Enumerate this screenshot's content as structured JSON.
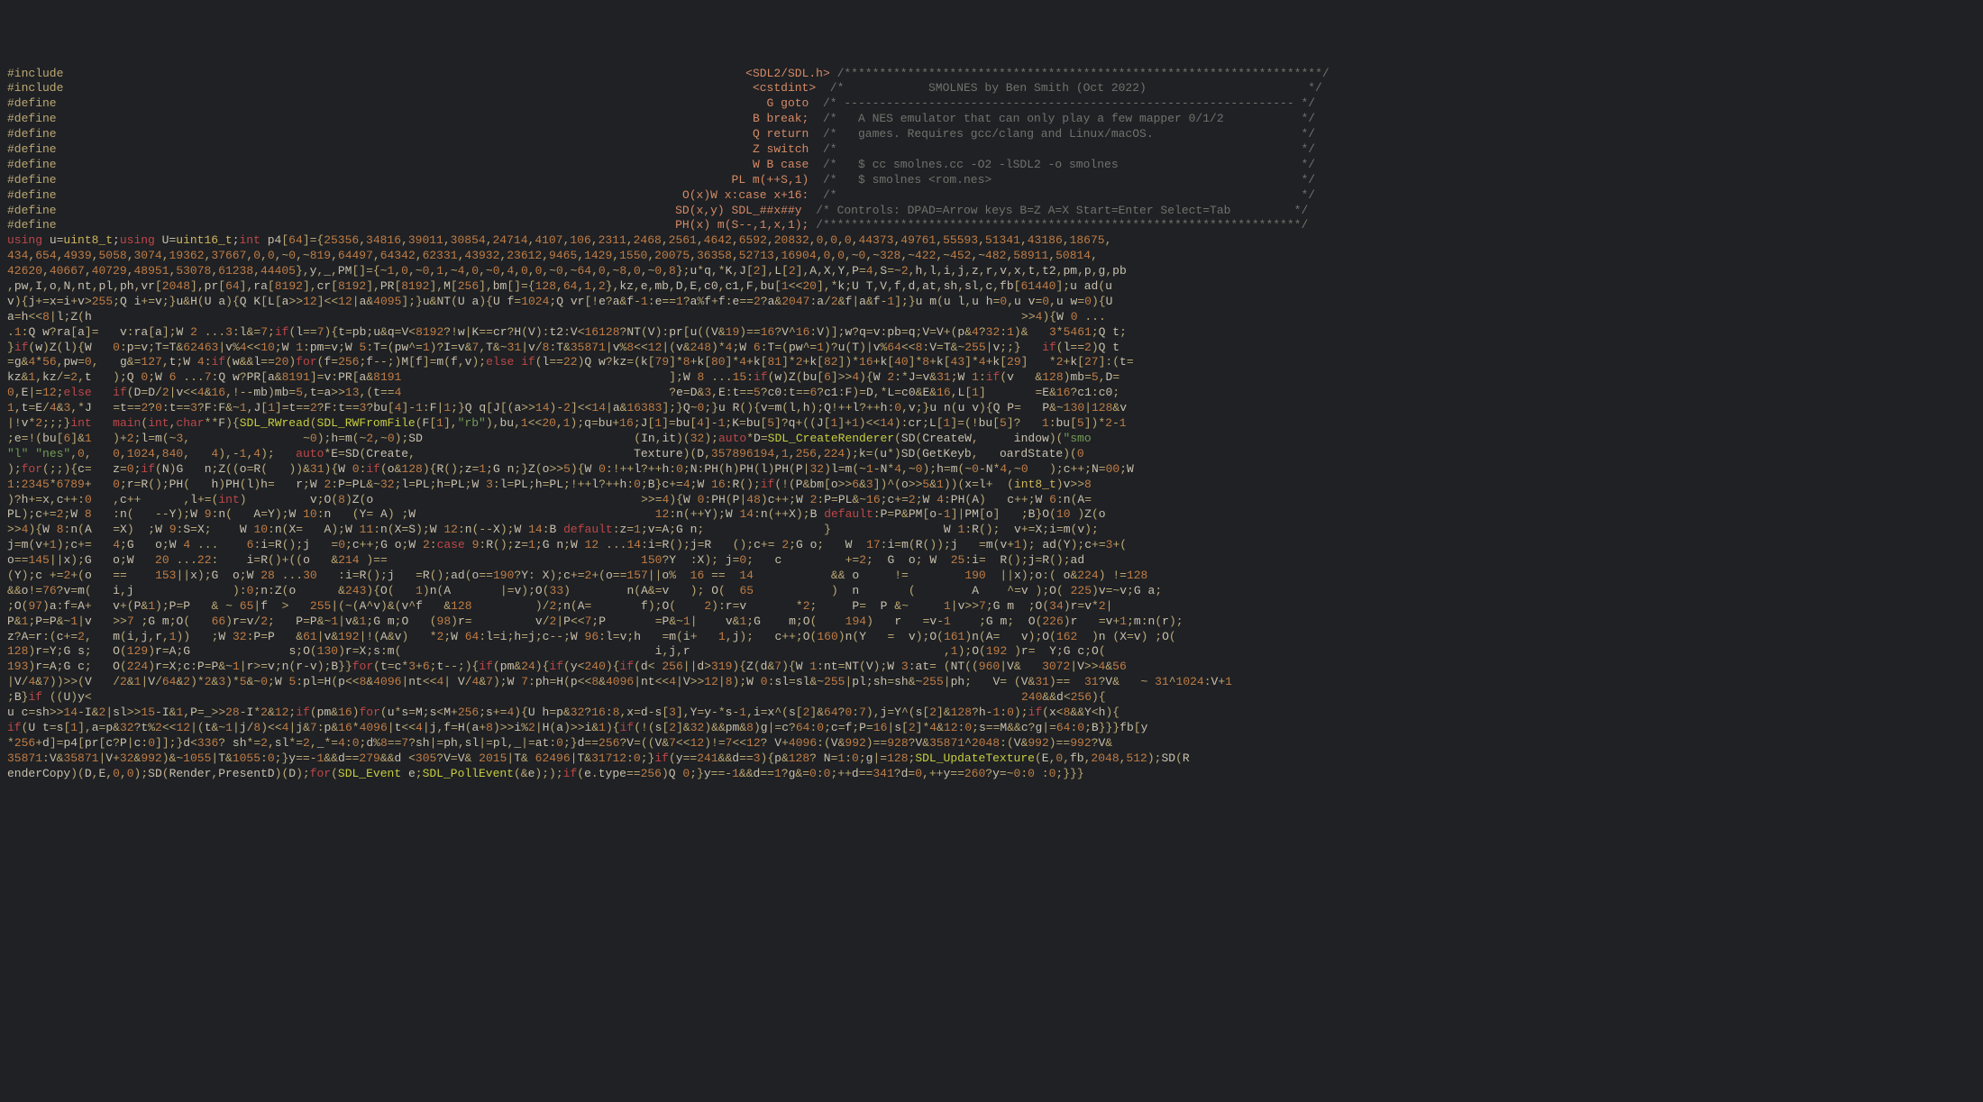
{
  "lines": [
    {
      "pp": "#include",
      "pad": "                                                                                                 ",
      "mac": "<SDL2/SDL.h>",
      "cmt": " /********************************************************************/"
    },
    {
      "pp": "#include",
      "pad": "                                                                                                  ",
      "mac": "<cstdint>",
      "cmt": "  /*            SMOLNES by Ben Smith (Oct 2022)                       */"
    },
    {
      "pp": "#define",
      "pad": "                                                                                                     ",
      "mac": "G goto",
      "cmt": "  /* ---------------------------------------------------------------- */"
    },
    {
      "pp": "#define",
      "pad": "                                                                                                   ",
      "mac": "B break;",
      "cmt": "  /*   A NES emulator that can only play a few mapper 0/1/2           */"
    },
    {
      "pp": "#define",
      "pad": "                                                                                                   ",
      "mac": "Q return",
      "cmt": "  /*   games. Requires gcc/clang and Linux/macOS.                     */"
    },
    {
      "pp": "#define",
      "pad": "                                                                                                   ",
      "mac": "Z switch",
      "cmt": "  /*                                                                  */"
    },
    {
      "pp": "#define",
      "pad": "                                                                                                   ",
      "mac": "W B case",
      "cmt": "  /*   $ cc smolnes.cc -O2 -lSDL2 -o smolnes                          */"
    },
    {
      "pp": "#define",
      "pad": "                                                                                                ",
      "mac": "PL m(++S,1)",
      "cmt": "  /*   $ smolnes <rom.nes>                                            */"
    },
    {
      "pp": "#define",
      "pad": "                                                                                         ",
      "mac": "O(x)W x:case x+16:",
      "cmt": "  /*                                                                  */"
    },
    {
      "pp": "#define",
      "pad": "                                                                                        ",
      "mac": "SD(x,y) SDL_##x##y",
      "cmt": "  /* Controls: DPAD=Arrow keys B=Z A=X Start=Enter Select=Tab         */"
    },
    {
      "pp": "#define",
      "pad": "                                                                                        ",
      "mac": "PH(x) m(S--,1,x,1);",
      "cmt": " /********************************************************************/"
    },
    {
      "kw": "using ",
      "id": "u=",
      "ty": "uint8_t",
      "id2": ";",
      "kw2": "using ",
      "id3": "U=",
      "ty2": "uint16_t",
      "id4": ";",
      "kw3": "int ",
      "rest": "p4[64]={25356,34816,39011,30854,24714,4107,106,2311,2468,2561,4642,6592,20832,0,0,0,44373,49761,55593,51341,43186,18675,"
    },
    {
      "rest": "434,654,4939,5058,3074,19362,37667,0,0,~0,~819,64497,64342,62331,43932,23612,9465,1429,1550,20075,36358,52713,16904,0,0,~0,~328,~422,~452,~482,58911,50814,"
    },
    {
      "rest": "42620,40667,40729,48951,53078,61238,44405},y,_,PM[]={~1,0,~0,1,~4,0,~0,4,0,0,~0,~64,0,~8,0,~0,8};u*q,*K,J[2],L[2],A,X,Y,P=4,S=~2,h,l,i,j,z,r,v,x,t,t2,pm,p,g,pb"
    },
    {
      "rest": ",pw,I,o,N,nt,pl,ph,vr[2048],pr[64],ra[8192],cr[8192],PR[8192],M[256],bm[]={128,64,1,2},kz,e,mb,D,E,c0,c1,F,bu[1<<20],*k;U T,V,f,d,at,sh,sl,c,fb[61440];u ad(u"
    },
    {
      "rest": "v){j+=x=i+v>255;Q i+=v;}u&H(U a){Q K[L[a>>12]<<12|a&4095];}u&NT(U a){U f=1024;Q vr[!e?a&f-1:e==1?a%f+f:e==2?a&2047:a/2&f|a&f-1];}u m(u l,u h=0,u v=0,u w=0){U"
    },
    {
      "rest": "a=h<<8|l;Z(h                                                                                                                                    >>4){W 0 ..."
    },
    {
      "rest": ".1:Q w?ra[a]=   v:ra[a];W 2 ...3:l&=7;if(l==7){t=pb;u&q=V<8192?!w|K==cr?H(V):t2:V<16128?NT(V):pr[u((V&19)==16?V^16:V)];w?q=v:pb=q;V=V+(p&4?32:1)&   3*5461;Q t;"
    },
    {
      "rest": "}if(w)Z(l){W   0:p=v;T=T&62463|v%4<<10;W 1:pm=v;W 5:T=(pw^=1)?I=v&7,T&~31|v/8:T&35871|v%8<<12|(v&248)*4;W 6:T=(pw^=1)?u(T)|v%64<<8:V=T&~255|v;;}   if(l==2)Q t"
    },
    {
      "rest": "=g&4*56,pw=0,   g&=127,t;W 4:if(w&&l==20)for(f=256;f--;)M[f]=m(f,v);else if(l==22)Q w?kz=(k[79]*8+k[80]*4+k[81]*2+k[82])*16+k[40]*8+k[43]*4+k[29]   *2+k[27]:(t="
    },
    {
      "rest": "kz&1,kz/=2,t   );Q 0;W 6 ...7:Q w?PR[a&8191]=v:PR[a&8191                                      ];W 8 ...15:if(w)Z(bu[6]>>4){W 2:*J=v&31;W 1:if(v   &128)mb=5,D="
    },
    {
      "rest": "0,E|=12;else   if(D=D/2|v<<4&16,!--mb)mb=5,t=a>>13,(t==4                                      ?e=D&3,E:t==5?c0:t==6?c1:F)=D,*L=c0&E&16,L[1]       =E&16?c1:c0;"
    },
    {
      "rest": "1,t=E/4&3,*J   =t==2?0:t==3?F:F&~1,J[1]=t==2?F:t==3?bu[4]-1:F|1;}Q q[J[(a>>14)-2]<<14|a&16383];}Q~0;}u R(){v=m(l,h);Q!++l?++h:0,v;}u n(u v){Q P=   P&~130|128&v"
    },
    {
      "rest": "|!v*2;;;}int   main(int,char**F){SDL_RWread(SDL_RWFromFile(F[1],\"rb\"),bu,1<<20,1);q=bu+16;J[1]=bu[4]-1;K=bu[5]?q+((J[1]+1)<<14):cr;L[1]=(!bu[5]?   1:bu[5])*2-1"
    },
    {
      "rest": ";e=!(bu[6]&1   )+2;l=m(~3,                ~0);h=m(~2,~0);SD                              (In,it)(32);auto*D=SDL_CreateRenderer(SD(CreateW,     indow)(\"smo"
    },
    {
      "rest": "\"l\" \"nes\",0,   0,1024,840,   4),-1,4);   auto*E=SD(Create,                               Texture)(D,357896194,1,256,224);k=(u*)SD(GetKeyb,   oardState)(0"
    },
    {
      "rest": ");for(;;){c=   z=0;if(N)G   n;Z((o=R(   ))&31){W 0:if(o&128){R();z=1;G n;}Z(o>>5){W 0:!++l?++h:0;N:PH(h)PH(l)PH(P|32)l=m(~1-N*4,~0);h=m(~0-N*4,~0   );c++;N=00;W"
    },
    {
      "rest": "1:2345*6789+   0;r=R();PH(   h)PH(l)h=   r;W 2:P=PL&~32;l=PL;h=PL;W 3:l=PL;h=PL;!++l?++h:0;B}c+=4;W 16:R();if(!(P&bm[o>>6&3])^(o>>5&1))(x=l+  (int8_t)v>>8"
    },
    {
      "rest": ")?h+=x,c++:0   ,c++      ,l+=(int)         v;O(8)Z(o                                      >>=4){W 0:PH(P|48)c++;W 2:P=PL&~16;c+=2;W 4:PH(A)   c++;W 6:n(A="
    },
    {
      "rest": "PL);c+=2;W 8   :n(   --Y);W 9:n(   A=Y);W 10:n   (Y= A) ;W                                  12:n(++Y);W 14:n(++X);B default:P=P&PM[o-1]|PM[o]   ;B}O(10 )Z(o"
    },
    {
      "rest": ">>4){W 8:n(A   =X)  ;W 9:S=X;    W 10:n(X=   A);W 11:n(X=S);W 12:n(--X);W 14:B default:z=1;v=A;G n;                 }                W 1:R();  v+=X;i=m(v);"
    },
    {
      "rest": "j=m(v+1);c+=   4;G   o;W 4 ...    6:i=R();j   =0;c++;G o;W 2:case 9:R();z=1;G n;W 12 ...14:i=R();j=R   ();c+= 2;G o;   W  17:i=m(R());j   =m(v+1); ad(Y);c+=3+("
    },
    {
      "rest": "o==145||x);G   o;W   20 ...22:    i=R()+((o   &214 )==                                    150?Y  :X); j=0;   c         +=2;  G  o; W  25:i=  R();j=R();ad"
    },
    {
      "rest": "(Y);c +=2+(o   ==    153||x);G  o;W 28 ...30   :i=R();j   =R();ad(o==190?Y: X);c+=2+(o==157||o%  16 ==  14           && o     !=        190  ||x);o:( o&224) !=128"
    },
    {
      "rest": "&&o!=76?v=m(   i,j              ):0;n:Z(o      &243){O(   1)n(A       |=v);O(33)        n(A&=v   ); O(  65           )  n       (        A    ^=v );O( 225)v=~v;G a;"
    },
    {
      "rest": ";O(97)a:f=A+   v+(P&1);P=P   & ~ 65|f  >   255|(~(A^v)&(v^f   &128         )/2;n(A=       f);O(    2):r=v       *2;     P=  P &~     1|v>>7;G m  ;O(34)r=v*2|"
    },
    {
      "rest": "P&1;P=P&~1|v   >>7 ;G m;O(   66)r=v/2;   P=P&~1|v&1;G m;O   (98)r=         v/2|P<<7;P       =P&~1|    v&1;G    m;O(    194)   r   =v-1    ;G m;  O(226)r   =v+1;m:n(r);"
    },
    {
      "rest": "z?A=r:(c+=2,   m(i,j,r,1))   ;W 32:P=P   &61|v&192|!(A&v)   *2;W 64:l=i;h=j;c--;W 96:l=v;h   =m(i+   1,j);   c++;O(160)n(Y   =  v);O(161)n(A=   v);O(162  )n (X=v) ;O("
    },
    {
      "rest": "128)r=Y;G s;   O(129)r=A;G              s;O(130)r=X;s:m(                                    i,j,r                                    ,1);O(192 )r=  Y;G c;O("
    },
    {
      "rest": "193)r=A;G c;   O(224)r=X;c:P=P&~1|r>=v;n(r-v);B}}for(t=c*3+6;t--;){if(pm&24){if(y<240){if(d< 256||d>319){Z(d&7){W 1:nt=NT(V);W 3:at= (NT((960|V&   3072|V>>4&56"
    },
    {
      "rest": "|V/4&7))>>(V   /2&1|V/64&2)*2&3)*5&~0;W 5:pl=H(p<<8&4096|nt<<4| V/4&7);W 7:ph=H(p<<8&4096|nt<<4|V>>12|8);W 0:sl=sl&~255|pl;sh=sh&~255|ph;   V= (V&31)==  31?V&   ~ 31^1024:V+1"
    },
    {
      "rest": ";B}if ((U)y<                                                                                                                                    240&&d<256){"
    },
    {
      "rest": "u c=sh>>14-I&2|sl>>15-I&1,P=_>>28-I*2&12;if(pm&16)for(u*s=M;s<M+256;s+=4){U h=p&32?16:8,x=d-s[3],Y=y-*s-1,i=x^(s[2]&64?0:7),j=Y^(s[2]&128?h-1:0);if(x<8&&Y<h){"
    },
    {
      "rest": "if(U t=s[1],a=p&32?t%2<<12|(t&~1|j/8)<<4|j&7:p&16*4096|t<<4|j,f=H(a+8)>>i%2|H(a)>>i&1){if(!(s[2]&32)&&pm&8)g|=c?64:0;c=f;P=16|s[2]*4&12:0;s==M&&c?g|=64:0;B}}}fb[y"
    },
    {
      "rest": "*256+d]=p4[pr[c?P|c:0]];}d<336? sh*=2,sl*=2,_*=4:0;d%8==7?sh|=ph,sl|=pl,_|=at:0;}d==256?V=((V&7<<12)!=7<<12? V+4096:(V&992)==928?V&35871^2048:(V&992)==992?V&"
    },
    {
      "rest": "35871:V&35871|V+32&992)&~1055|T&1055:0;}y==-1&&d==279&&d <305?V=V& 2015|T& 62496|T&31712:0;}if(y==241&&d==3){p&128? N=1:0;g|=128;SDL_UpdateTexture(E,0,fb,2048,512);SD(R"
    },
    {
      "rest": "enderCopy)(D,E,0,0);SD(Render,PresentD)(D);for(SDL_Event e;SDL_PollEvent(&e););if(e.type==256)Q 0;}y==-1&&d==1?g&=0:0;++d==341?d=0,++y==260?y=~0:0 :0;}}}"
    }
  ]
}
